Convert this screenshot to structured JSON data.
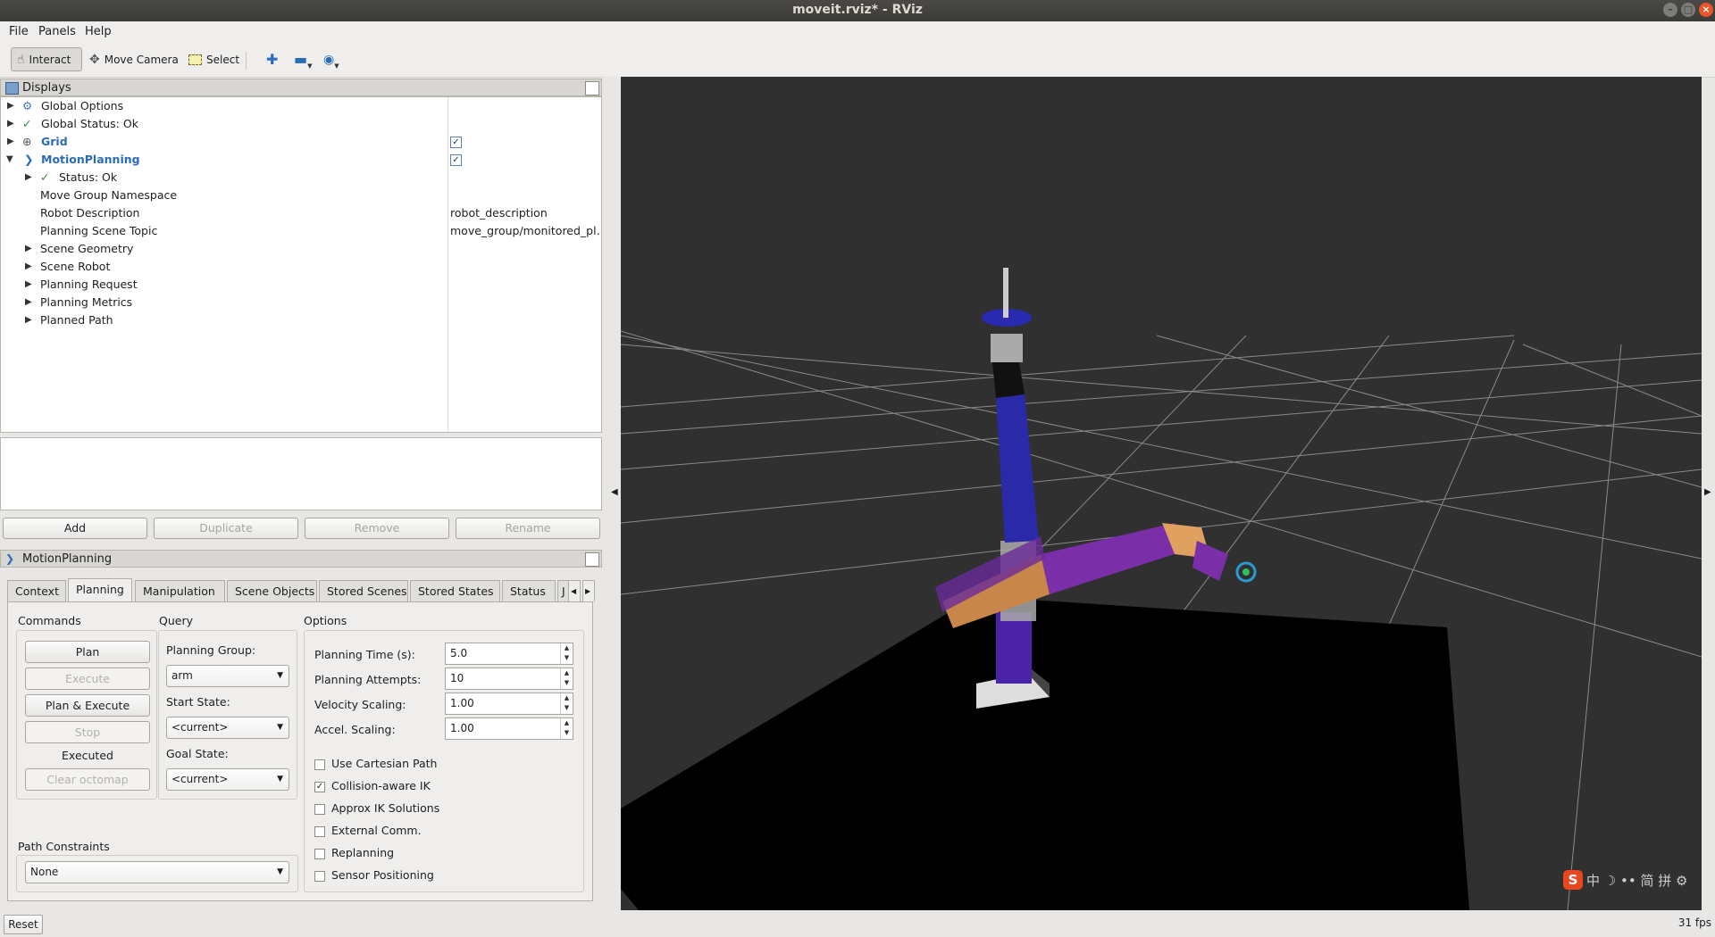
{
  "window": {
    "title": "moveit.rviz* - RViz"
  },
  "menubar": {
    "items": [
      "File",
      "Panels",
      "Help"
    ]
  },
  "toolbar": {
    "interact": "Interact",
    "move_camera": "Move Camera",
    "select": "Select"
  },
  "displays": {
    "title": "Displays",
    "rows": [
      {
        "label": "Global Options"
      },
      {
        "label": "Global Status: Ok"
      },
      {
        "label": "Grid",
        "checked": true
      },
      {
        "label": "MotionPlanning",
        "checked": true
      },
      {
        "label": "Status: Ok"
      },
      {
        "label": "Move Group Namespace",
        "value": ""
      },
      {
        "label": "Robot Description",
        "value": "robot_description"
      },
      {
        "label": "Planning Scene Topic",
        "value": "move_group/monitored_pl…"
      },
      {
        "label": "Scene Geometry"
      },
      {
        "label": "Scene Robot"
      },
      {
        "label": "Planning Request"
      },
      {
        "label": "Planning Metrics"
      },
      {
        "label": "Planned Path"
      }
    ],
    "buttons": {
      "add": "Add",
      "duplicate": "Duplicate",
      "remove": "Remove",
      "rename": "Rename"
    }
  },
  "motion_panel": {
    "title": "MotionPlanning",
    "tabs": [
      "Context",
      "Planning",
      "Manipulation",
      "Scene Objects",
      "Stored Scenes",
      "Stored States",
      "Status",
      "J"
    ],
    "selected_tab": "Planning",
    "commands": {
      "title": "Commands",
      "plan": "Plan",
      "execute": "Execute",
      "plan_execute": "Plan & Execute",
      "stop": "Stop",
      "status": "Executed",
      "clear_octomap": "Clear octomap"
    },
    "query": {
      "title": "Query",
      "planning_group_label": "Planning Group:",
      "planning_group": "arm",
      "start_state_label": "Start State:",
      "start_state": "<current>",
      "goal_state_label": "Goal State:",
      "goal_state": "<current>"
    },
    "options": {
      "title": "Options",
      "planning_time_label": "Planning Time (s):",
      "planning_time": "5.0",
      "planning_attempts_label": "Planning Attempts:",
      "planning_attempts": "10",
      "velocity_scaling_label": "Velocity Scaling:",
      "velocity_scaling": "1.00",
      "accel_scaling_label": "Accel. Scaling:",
      "accel_scaling": "1.00",
      "checks": [
        {
          "label": "Use Cartesian Path",
          "checked": false
        },
        {
          "label": "Collision-aware IK",
          "checked": true
        },
        {
          "label": "Approx IK Solutions",
          "checked": false
        },
        {
          "label": "External Comm.",
          "checked": false
        },
        {
          "label": "Replanning",
          "checked": false
        },
        {
          "label": "Sensor Positioning",
          "checked": false
        }
      ]
    },
    "path_constraints": {
      "label": "Path Constraints",
      "value": "None"
    }
  },
  "footer": {
    "reset": "Reset",
    "fps": "31 fps"
  },
  "ime": {
    "glyphs": "中 ☽ •• 简 拼 ⚙"
  }
}
